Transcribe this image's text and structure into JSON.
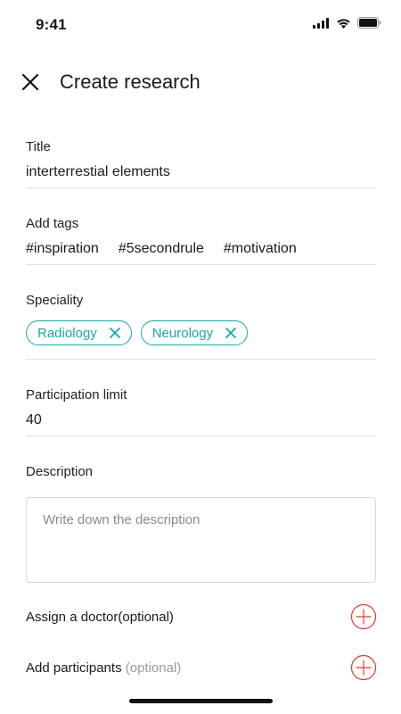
{
  "status_bar": {
    "time": "9:41"
  },
  "header": {
    "title": "Create research"
  },
  "form": {
    "title_field": {
      "label": "Title",
      "value": "interterrestial elements"
    },
    "tags_field": {
      "label": "Add tags",
      "tags": [
        "#inspiration",
        "#5secondrule",
        "#motivation"
      ]
    },
    "speciality_field": {
      "label": "Speciality",
      "chips": [
        "Radiology",
        "Neurology"
      ]
    },
    "limit_field": {
      "label": "Participation limit",
      "value": "40"
    },
    "description_field": {
      "label": "Description",
      "placeholder": "Write down the description"
    },
    "assign_doctor": {
      "label": "Assign a doctor(optional)"
    },
    "add_participants": {
      "label": "Add participants",
      "optional": "(optional)"
    }
  },
  "colors": {
    "accent": "#19a8a8",
    "add": "#e53935",
    "divider": "#e2e2e2"
  },
  "icons": {
    "close": "close-icon",
    "chip_remove": "close-icon",
    "add": "plus-circle-icon"
  }
}
